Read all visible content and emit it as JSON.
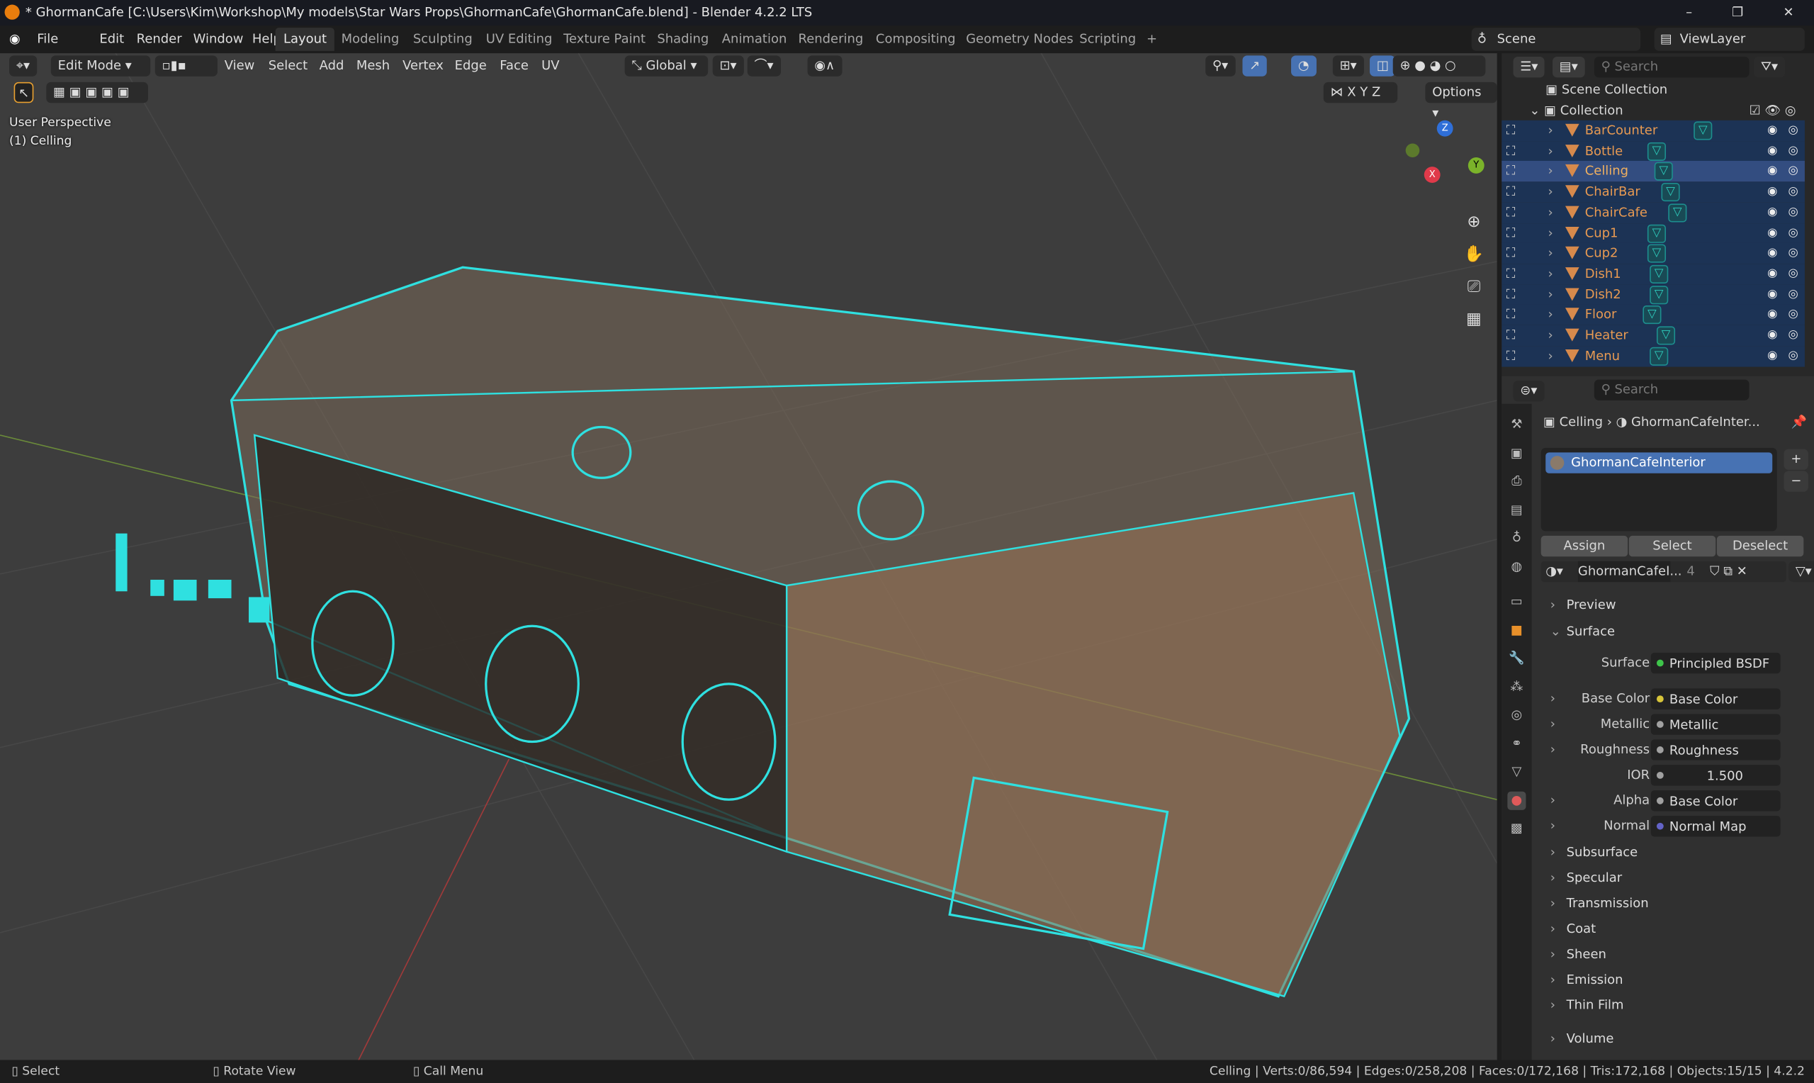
{
  "window": {
    "title": "* GhormanCafe [C:\\Users\\Kim\\Workshop\\My models\\Star Wars Props\\GhormanCafe\\GhormanCafe.blend] - Blender 4.2.2 LTS",
    "minimize": "–",
    "maximize": "❐",
    "close": "✕"
  },
  "menus": [
    "File",
    "Edit",
    "Render",
    "Window",
    "Help"
  ],
  "workspaces": [
    "Layout",
    "Modeling",
    "Sculpting",
    "UV Editing",
    "Texture Paint",
    "Shading",
    "Animation",
    "Rendering",
    "Compositing",
    "Geometry Nodes",
    "Scripting",
    "+"
  ],
  "scene": {
    "label": "Scene",
    "viewlayer": "ViewLayer"
  },
  "viewport": {
    "mode": "Edit Mode",
    "menus": [
      "View",
      "Select",
      "Add",
      "Mesh",
      "Vertex",
      "Edge",
      "Face",
      "UV"
    ],
    "orientation": "Global",
    "axes": [
      "X",
      "Y",
      "Z"
    ],
    "options": "Options",
    "perspective": "User Perspective",
    "object": "(1) Celling",
    "gizmo": {
      "x": "X",
      "y": "Y",
      "z": "Z"
    }
  },
  "outliner": {
    "search_placeholder": "Search",
    "scene_collection": "Scene Collection",
    "collection": "Collection",
    "items": [
      "BarCounter",
      "Bottle",
      "Celling",
      "ChairBar",
      "ChairCafe",
      "Cup1",
      "Cup2",
      "Dish1",
      "Dish2",
      "Floor",
      "Heater",
      "Menu"
    ],
    "active": "Celling"
  },
  "properties": {
    "search_placeholder": "Search",
    "breadcrumb_object": "Celling",
    "breadcrumb_material": "GhormanCafeInter...",
    "slot": "GhormanCafeInterior",
    "buttons": [
      "Assign",
      "Select",
      "Deselect"
    ],
    "material_name": "GhormanCafeI...",
    "users": "4",
    "sections": {
      "preview": "Preview",
      "surface": "Surface",
      "volume": "Volume"
    },
    "rows": [
      {
        "label": "Surface",
        "value": "Principled BSDF",
        "dot": "#3ec44a",
        "expand": false
      },
      {
        "label": "Base Color",
        "value": "Base Color",
        "dot": "#d8c53a",
        "expand": true
      },
      {
        "label": "Metallic",
        "value": "Metallic",
        "dot": "#a1a1a1",
        "expand": true
      },
      {
        "label": "Roughness",
        "value": "Roughness",
        "dot": "#a1a1a1",
        "expand": true
      },
      {
        "label": "IOR",
        "value": "1.500",
        "dot": "#a1a1a1",
        "expand": false
      },
      {
        "label": "Alpha",
        "value": "Base Color",
        "dot": "#a1a1a1",
        "expand": true
      },
      {
        "label": "Normal",
        "value": "Normal Map",
        "dot": "#6363c7",
        "expand": true
      }
    ],
    "subpanels": [
      "Subsurface",
      "Specular",
      "Transmission",
      "Coat",
      "Sheen",
      "Emission",
      "Thin Film"
    ]
  },
  "status": {
    "left": [
      "Select",
      "Rotate View",
      "Call Menu"
    ],
    "stats": "Celling | Verts:0/86,594 | Edges:0/258,208 | Faces:0/172,168 | Tris:172,168 | Objects:15/15 | 4.2.2"
  },
  "colors": {
    "wire": "#2fe0e0",
    "accent": "#4772b3",
    "object_name": "#e89a52"
  }
}
